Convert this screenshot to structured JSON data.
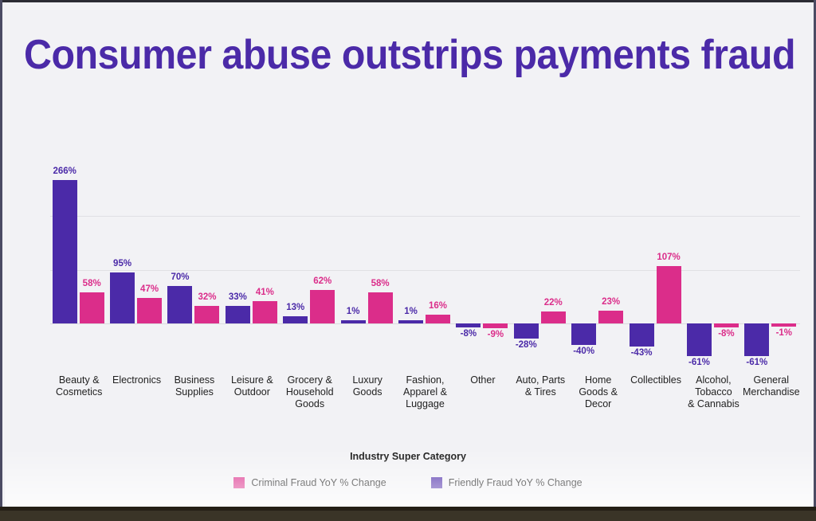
{
  "slide": {
    "title": "Consumer abuse outstrips payments fraud",
    "title_color": "#4b2aa8",
    "background_color": "#f2f2f5"
  },
  "chart_data": {
    "type": "bar",
    "title": "Consumer abuse outstrips payments fraud",
    "xlabel": "Industry Super Category",
    "ylabel": "",
    "ylim": [
      -100,
      300
    ],
    "grid": true,
    "legend_position": "bottom",
    "yticks": [
      "0%",
      "100%",
      "200%"
    ],
    "ytick_values": [
      0,
      100,
      200
    ],
    "categories": [
      "Beauty &\nCosmetics",
      "Electronics",
      "Business\nSupplies",
      "Leisure &\nOutdoor",
      "Grocery &\nHousehold\nGoods",
      "Luxury\nGoods",
      "Fashion,\nApparel &\nLuggage",
      "Other",
      "Auto, Parts\n& Tires",
      "Home\nGoods &\nDecor",
      "Collectibles",
      "Alcohol,\nTobacco\n& Cannabis",
      "General\nMerchandise"
    ],
    "series": [
      {
        "name": "Friendly Fraud YoY % Change",
        "color": "#4b2aa8",
        "values": [
          266,
          95,
          70,
          33,
          13,
          1,
          1,
          -8,
          -28,
          -40,
          -43,
          -61,
          -61
        ],
        "labels": [
          "266%",
          "95%",
          "70%",
          "33%",
          "13%",
          "1%",
          "1%",
          "-8%",
          "-28%",
          "-40%",
          "-43%",
          "-61%",
          "-61%"
        ]
      },
      {
        "name": "Criminal Fraud YoY % Change",
        "color": "#db2d8a",
        "values": [
          58,
          47,
          32,
          41,
          62,
          58,
          16,
          -9,
          22,
          23,
          107,
          -8,
          -1
        ],
        "labels": [
          "58%",
          "47%",
          "32%",
          "41%",
          "62%",
          "58%",
          "16%",
          "-9%",
          "22%",
          "23%",
          "107%",
          "-8%",
          "-1%"
        ]
      }
    ]
  },
  "legend": [
    {
      "label": "Criminal Fraud YoY % Change",
      "color": "#db2d8a"
    },
    {
      "label": "Friendly Fraud YoY % Change",
      "color": "#4b2aa8"
    }
  ],
  "axis": {
    "x_title": "Industry Super Category"
  }
}
